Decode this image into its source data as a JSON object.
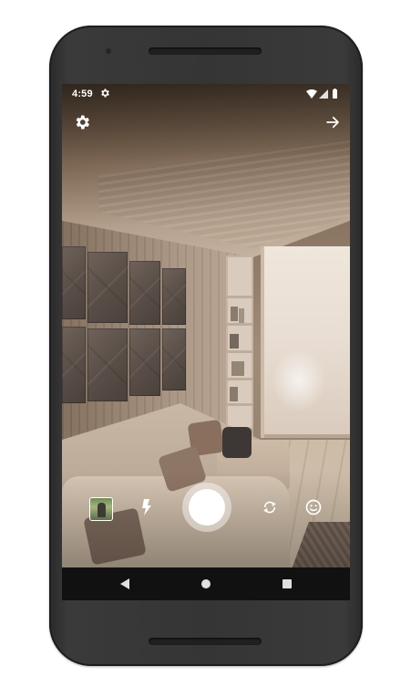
{
  "status_bar": {
    "time": "4:59",
    "settings_icon": "gear-icon",
    "wifi_icon": "wifi-icon",
    "signal_icon": "signal-icon",
    "battery_icon": "battery-icon"
  },
  "top_bar": {
    "settings_icon": "gear-icon",
    "next_icon": "arrow-right-icon"
  },
  "camera_controls": {
    "gallery_icon": "gallery-thumbnail",
    "flash_icon": "flash-icon",
    "shutter_icon": "shutter-button",
    "switch_camera_icon": "switch-camera-icon",
    "face_icon": "face-icon"
  },
  "nav_bar": {
    "back_icon": "back-triangle-icon",
    "home_icon": "home-circle-icon",
    "recents_icon": "recents-square-icon"
  },
  "colors": {
    "status_text": "#ffffff",
    "nav_background": "#111111",
    "phone_body": "#353535",
    "shutter": "#ffffff"
  }
}
